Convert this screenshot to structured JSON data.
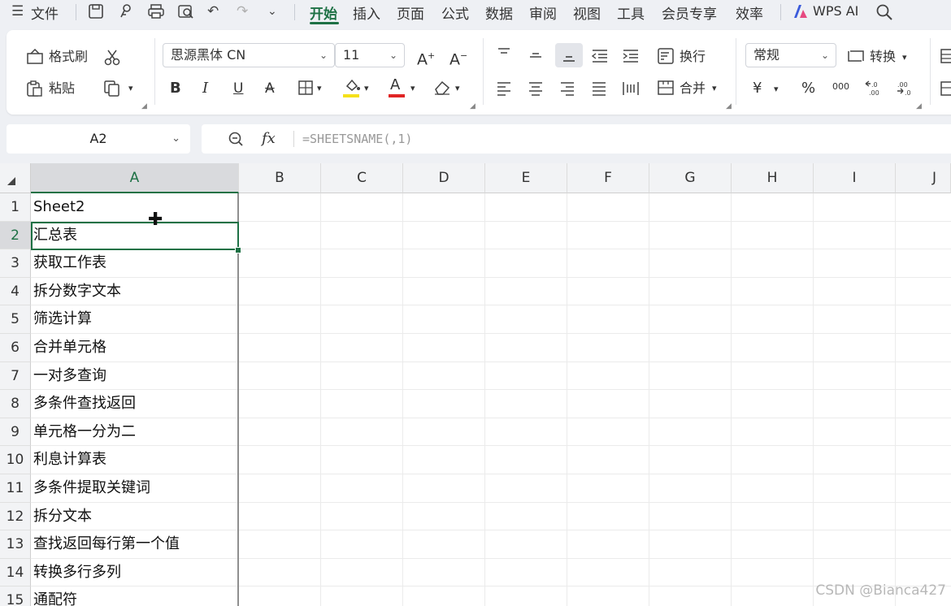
{
  "menubar": {
    "file_label": "文件",
    "tabs": [
      "开始",
      "插入",
      "页面",
      "公式",
      "数据",
      "审阅",
      "视图",
      "工具",
      "会员专享",
      "效率"
    ],
    "wps_ai": "WPS AI"
  },
  "ribbon": {
    "format_painter": "格式刷",
    "paste": "粘贴",
    "font_name": "思源黑体 CN",
    "font_size": "11",
    "wrap": "换行",
    "merge": "合并",
    "number_format": "常规",
    "convert": "转换",
    "currency_symbol": "¥",
    "percent_symbol": "%",
    "thousands_symbol": "000",
    "colors": {
      "highlight": "#f5e11a",
      "font_color": "#e02424"
    }
  },
  "formula_bar": {
    "name_box": "A2",
    "fx": "fx",
    "formula": "=SHEETSNAME(,1)"
  },
  "sheet": {
    "columns": [
      "A",
      "B",
      "C",
      "D",
      "E",
      "F",
      "G",
      "H",
      "I",
      "J"
    ],
    "rows": [
      "1",
      "2",
      "3",
      "4",
      "5",
      "6",
      "7",
      "8",
      "9",
      "10",
      "11",
      "12",
      "13",
      "14",
      "15"
    ],
    "column_a": [
      "Sheet2",
      "汇总表",
      "获取工作表",
      "拆分数字文本",
      "筛选计算",
      "合并单元格",
      "一对多查询",
      "多条件查找返回",
      "单元格一分为二",
      "利息计算表",
      "多条件提取关键词",
      "拆分文本",
      "查找返回每行第一个值",
      "转换多行多列",
      "通配符"
    ],
    "active_cell": "A2",
    "accent_color": "#1e7145"
  },
  "watermark": "CSDN @Bianca427"
}
